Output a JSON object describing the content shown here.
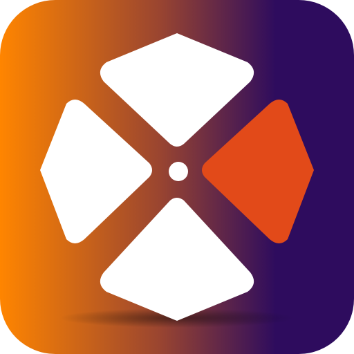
{
  "icon": {
    "name": "app-icon",
    "semantic": "four-petal-crosshair-icon",
    "colors": {
      "gradient_start": "#FF8500",
      "gradient_mid": "#9A4530",
      "gradient_end": "#2E0C5E",
      "petal": "#FFFFFF",
      "accent_petal": "#E24A19",
      "center_dot": "#FFFFFF"
    },
    "highlighted_petal": "right"
  }
}
